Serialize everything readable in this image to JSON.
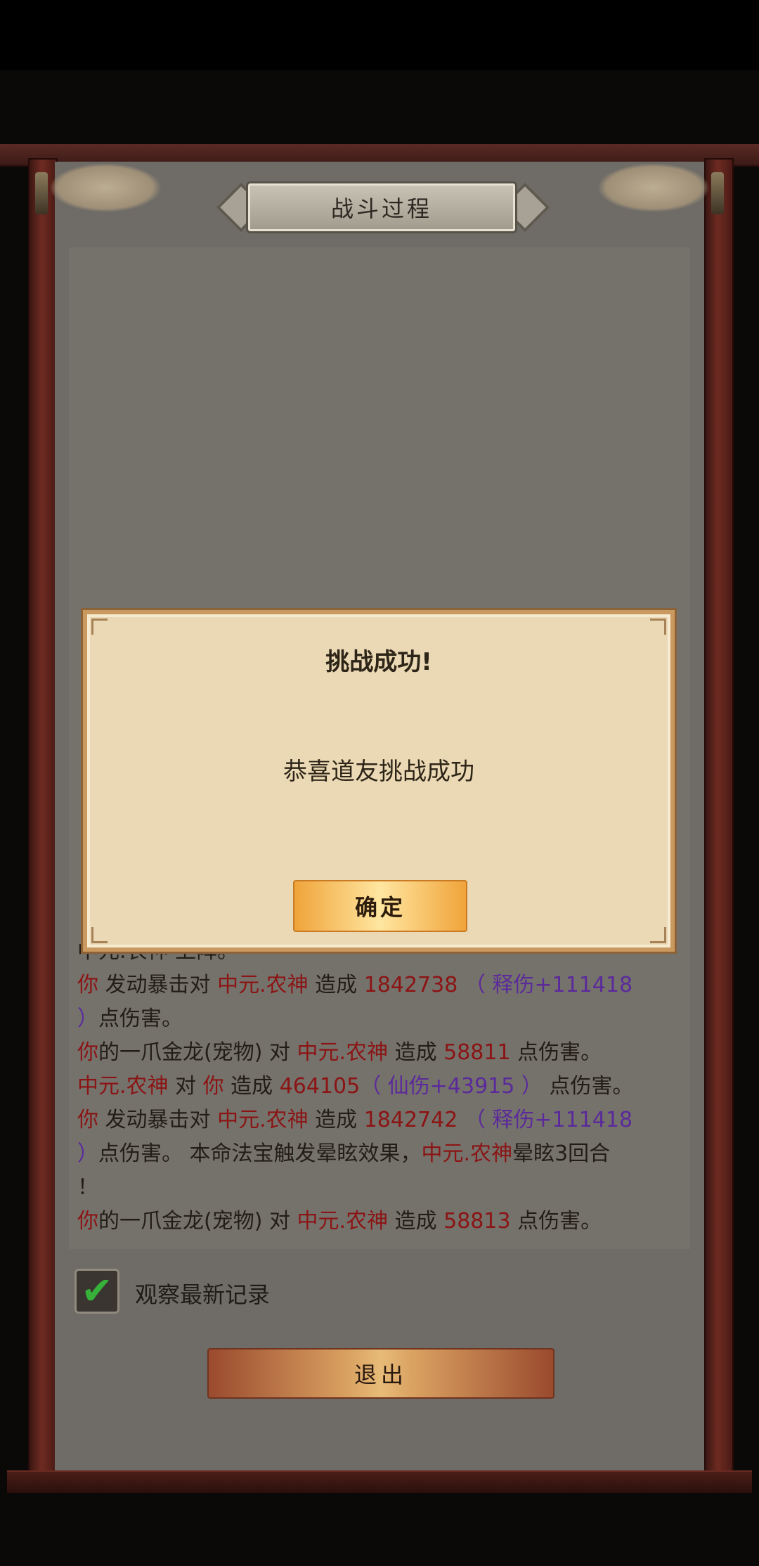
{
  "window": {
    "title": "战斗过程"
  },
  "log": {
    "lines": [
      [
        {
          "t": "中元.农神 上阵。",
          "c": "dark"
        }
      ],
      [
        {
          "t": "你",
          "c": "red"
        },
        {
          "t": " 发动暴击对 ",
          "c": "dark"
        },
        {
          "t": "中元.农神",
          "c": "red"
        },
        {
          "t": " 造成 ",
          "c": "dark"
        },
        {
          "t": "1842738",
          "c": "red"
        },
        {
          "t": " （ 释伤+111418",
          "c": "purple"
        }
      ],
      [
        {
          "t": "）",
          "c": "purple"
        },
        {
          "t": "点伤害。",
          "c": "dark"
        }
      ],
      [
        {
          "t": "你",
          "c": "red"
        },
        {
          "t": "的一爪金龙(宠物) 对 ",
          "c": "dark"
        },
        {
          "t": "中元.农神",
          "c": "red"
        },
        {
          "t": " 造成 ",
          "c": "dark"
        },
        {
          "t": "58811",
          "c": "red"
        },
        {
          "t": " 点伤害。",
          "c": "dark"
        }
      ],
      [
        {
          "t": "中元.农神",
          "c": "red"
        },
        {
          "t": " 对 ",
          "c": "dark"
        },
        {
          "t": "你",
          "c": "red"
        },
        {
          "t": " 造成 ",
          "c": "dark"
        },
        {
          "t": "464105",
          "c": "red"
        },
        {
          "t": "（ 仙伤+43915 ）",
          "c": "purple"
        },
        {
          "t": " 点伤害。",
          "c": "dark"
        }
      ],
      [
        {
          "t": "你",
          "c": "red"
        },
        {
          "t": " 发动暴击对 ",
          "c": "dark"
        },
        {
          "t": "中元.农神",
          "c": "red"
        },
        {
          "t": " 造成 ",
          "c": "dark"
        },
        {
          "t": "1842742",
          "c": "red"
        },
        {
          "t": " （ 释伤+111418",
          "c": "purple"
        }
      ],
      [
        {
          "t": "）",
          "c": "purple"
        },
        {
          "t": "点伤害。 本命法宝触发晕眩效果，",
          "c": "dark"
        },
        {
          "t": "中元.农神",
          "c": "red"
        },
        {
          "t": "晕眩3回合",
          "c": "dark"
        }
      ],
      [
        {
          "t": "！",
          "c": "dark"
        }
      ],
      [
        {
          "t": "你",
          "c": "red"
        },
        {
          "t": "的一爪金龙(宠物) 对 ",
          "c": "dark"
        },
        {
          "t": "中元.农神",
          "c": "red"
        },
        {
          "t": " 造成 ",
          "c": "dark"
        },
        {
          "t": "58813",
          "c": "red"
        },
        {
          "t": " 点伤害。",
          "c": "dark"
        }
      ]
    ]
  },
  "observe": {
    "label": "观察最新记录",
    "checked": true
  },
  "exit": {
    "label": "退出"
  },
  "dialog": {
    "title": "挑战成功!",
    "message": "恭喜道友挑战成功",
    "confirm_label": "确定"
  },
  "colors": {
    "red": "#8b1414",
    "purple": "#5b2a9a",
    "check": "#36b13a"
  }
}
